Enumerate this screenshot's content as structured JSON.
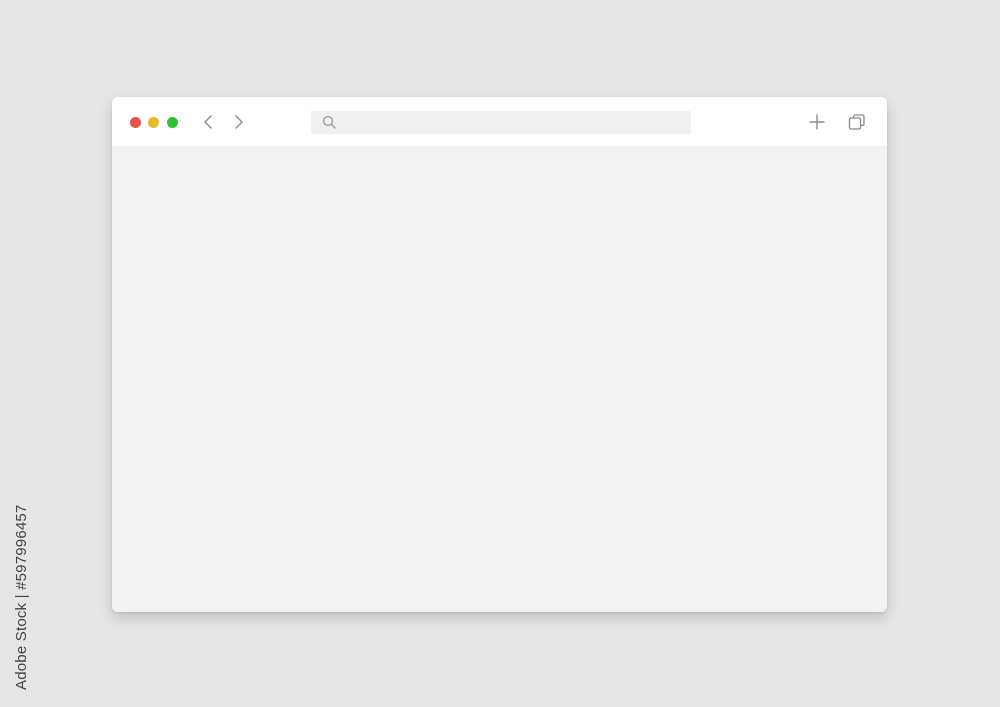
{
  "window_controls": {
    "close_color": "#e5534b",
    "minimize_color": "#e8b923",
    "maximize_color": "#2ec12e"
  },
  "toolbar": {
    "icons": {
      "back": "chevron-left-icon",
      "forward": "chevron-right-icon",
      "search": "search-icon",
      "new_tab": "plus-icon",
      "tabs": "tabs-icon"
    }
  },
  "address_bar": {
    "value": "",
    "placeholder": ""
  },
  "watermark": {
    "stock_id": "Adobe Stock | #597996457"
  }
}
